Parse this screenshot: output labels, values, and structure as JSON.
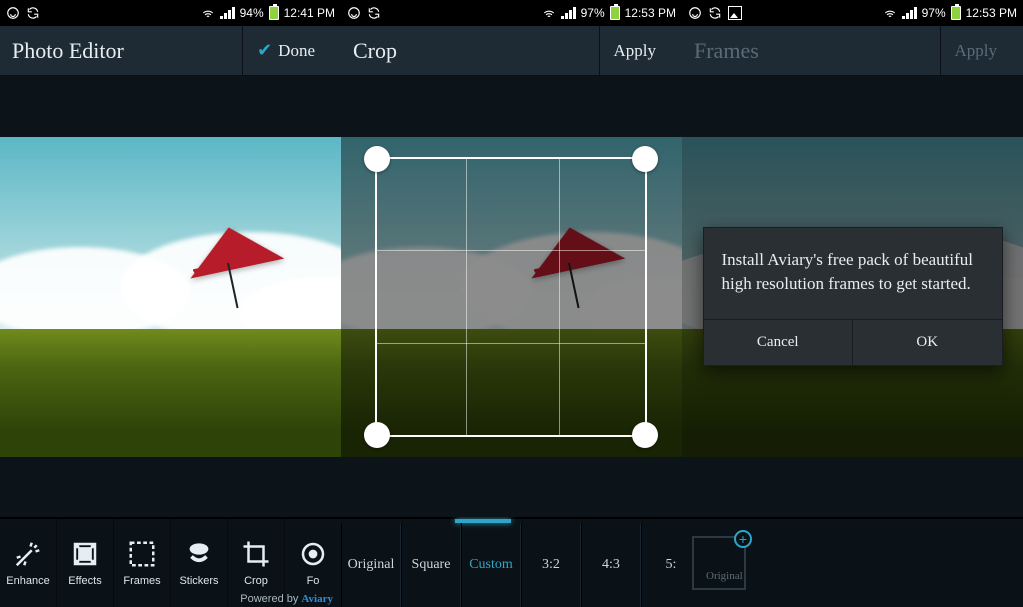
{
  "screens": [
    {
      "status": {
        "battery": "94%",
        "time": "12:41 PM"
      },
      "title": "Photo Editor",
      "action": {
        "label": "Done",
        "icon": "check-icon"
      },
      "toolbar": [
        {
          "label": "Enhance"
        },
        {
          "label": "Effects"
        },
        {
          "label": "Frames"
        },
        {
          "label": "Stickers"
        },
        {
          "label": "Crop"
        },
        {
          "label": "Fo"
        }
      ],
      "powered": {
        "prefix": "Powered by ",
        "brand": "Aviary"
      }
    },
    {
      "status": {
        "battery": "97%",
        "time": "12:53 PM"
      },
      "title": "Crop",
      "action": {
        "label": "Apply"
      },
      "ratios": [
        {
          "label": "Original",
          "active": false
        },
        {
          "label": "Square",
          "active": false
        },
        {
          "label": "Custom",
          "active": true
        },
        {
          "label": "3:2",
          "active": false
        },
        {
          "label": "4:3",
          "active": false
        },
        {
          "label": "5:",
          "active": false
        }
      ]
    },
    {
      "status": {
        "battery": "97%",
        "time": "12:53 PM"
      },
      "title": "Frames",
      "action": {
        "label": "Apply"
      },
      "frame_thumb": {
        "label": "Original"
      },
      "dialog": {
        "message": "Install Aviary's free pack of beautiful high resolution frames to get started.",
        "cancel": "Cancel",
        "ok": "OK"
      }
    }
  ]
}
